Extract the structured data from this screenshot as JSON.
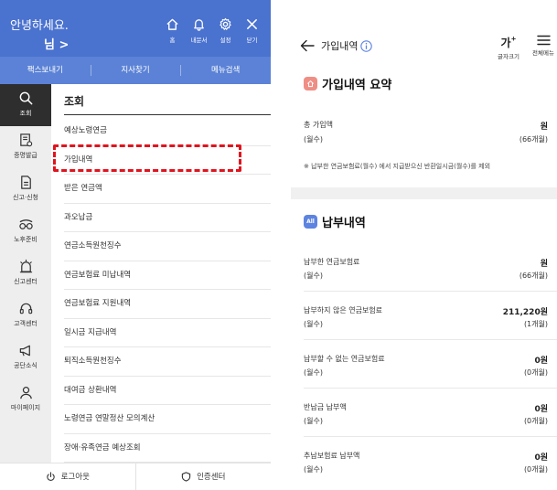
{
  "left": {
    "greeting": "안녕하세요.",
    "username_suffix": "님 >",
    "top_icons": [
      {
        "icon": "home-icon",
        "label": "홈"
      },
      {
        "icon": "bell-icon",
        "label": "내문서"
      },
      {
        "icon": "gear-icon",
        "label": "설정"
      },
      {
        "icon": "close-icon",
        "label": "닫기"
      }
    ],
    "sub_links": [
      "팩스보내기",
      "지사찾기",
      "메뉴검색"
    ],
    "sidenav": [
      {
        "icon": "search-icon",
        "label": "조회",
        "active": true
      },
      {
        "icon": "certificate-icon",
        "label": "증명발급"
      },
      {
        "icon": "document-icon",
        "label": "신고·신청"
      },
      {
        "icon": "glasses-icon",
        "label": "노후준비"
      },
      {
        "icon": "alarm-icon",
        "label": "신고센터"
      },
      {
        "icon": "headset-icon",
        "label": "고객센터"
      },
      {
        "icon": "megaphone-icon",
        "label": "공단소식"
      },
      {
        "icon": "person-icon",
        "label": "마이페이지"
      }
    ],
    "menu_title": "조회",
    "menu_items": [
      "예상노령연금",
      "가입내역",
      "받은 연금액",
      "과오납금",
      "연금소득원천징수",
      "연금보험료 미납내역",
      "연금보험료 지원내역",
      "일시금 지급내역",
      "퇴직소득원천징수",
      "대여금 상환내역",
      "노령연금 연말정산 모의계산",
      "장애·유족연금 예상조회"
    ],
    "bottom": [
      {
        "icon": "power-icon",
        "label": "로그아웃"
      },
      {
        "icon": "shield-icon",
        "label": "인증센터"
      }
    ],
    "highlight_color": "#e0141e",
    "brand_color": "#4a72cf"
  },
  "right": {
    "title": "가입내역",
    "font_size_glyph": "가",
    "font_size_plus": "+",
    "font_size_label": "글자크기",
    "menu_label": "전체메뉴",
    "summary_title": "가입내역 요약",
    "summary_rows": [
      {
        "label": "총 가입액",
        "sub": "(월수)",
        "value": "원",
        "subvalue": "(66개월)"
      }
    ],
    "note": "※ 납부한 연금보험료(월수) 에서 지급받으신 반환일시금(월수)를 제외",
    "payment_badge": "All",
    "payment_title": "납부내역",
    "payment_rows": [
      {
        "label": "납부한 연금보험료",
        "sub": "(월수)",
        "value": "원",
        "subvalue": "(66개월)"
      },
      {
        "label": "납부하지 않은 연금보험료",
        "sub": "(월수)",
        "value": "211,220원",
        "subvalue": "(1개월)"
      },
      {
        "label": "납부할 수 없는 연금보험료",
        "sub": "(월수)",
        "value": "0원",
        "subvalue": "(0개월)"
      },
      {
        "label": "반납금 납부액",
        "sub": "(월수)",
        "value": "0원",
        "subvalue": "(0개월)"
      },
      {
        "label": "추납보험료 납부액",
        "sub": "(월수)",
        "value": "0원",
        "subvalue": "(0개월)"
      }
    ]
  }
}
